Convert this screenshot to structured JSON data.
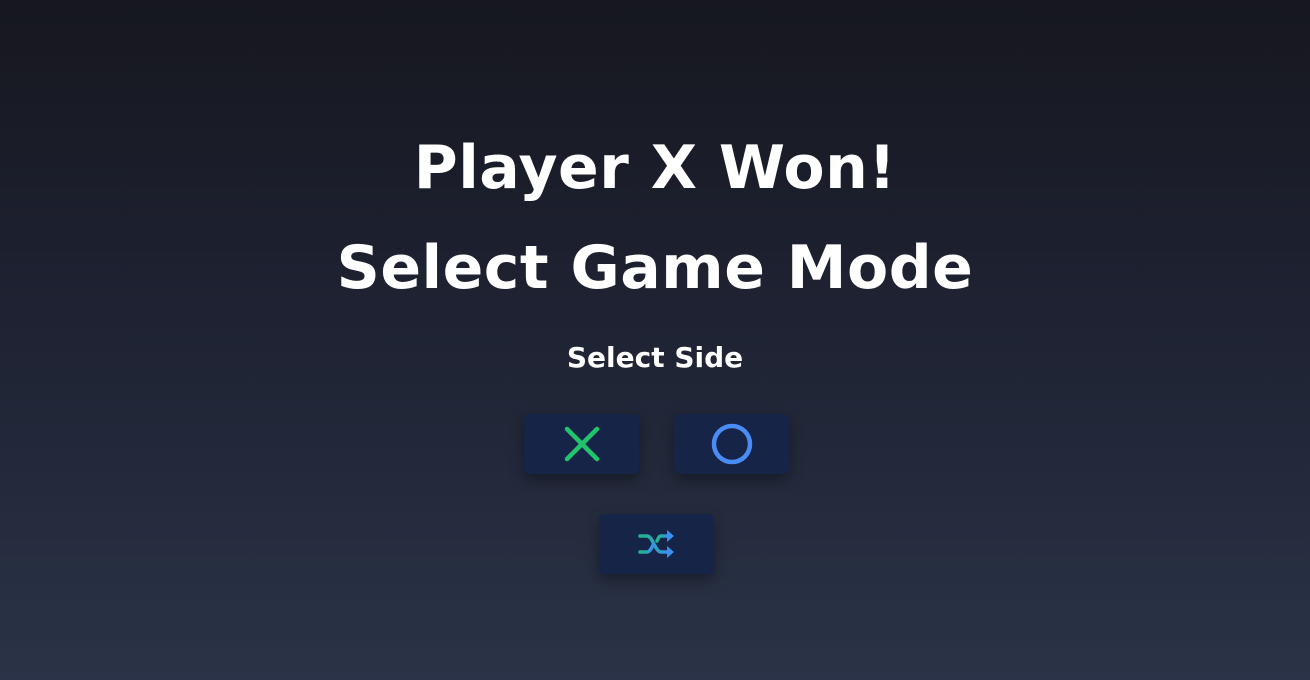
{
  "result": {
    "title": "Player X Won!"
  },
  "mode": {
    "title": "Select Game Mode"
  },
  "side_select": {
    "label": "Select Side",
    "options": [
      {
        "icon": "x-icon",
        "color": "#1fc46b"
      },
      {
        "icon": "circle-icon",
        "color": "#4a8cf5"
      },
      {
        "icon": "shuffle-icon",
        "color": "#2aa6c9"
      }
    ]
  },
  "colors": {
    "button_bg": "#162447",
    "text": "#ffffff"
  }
}
